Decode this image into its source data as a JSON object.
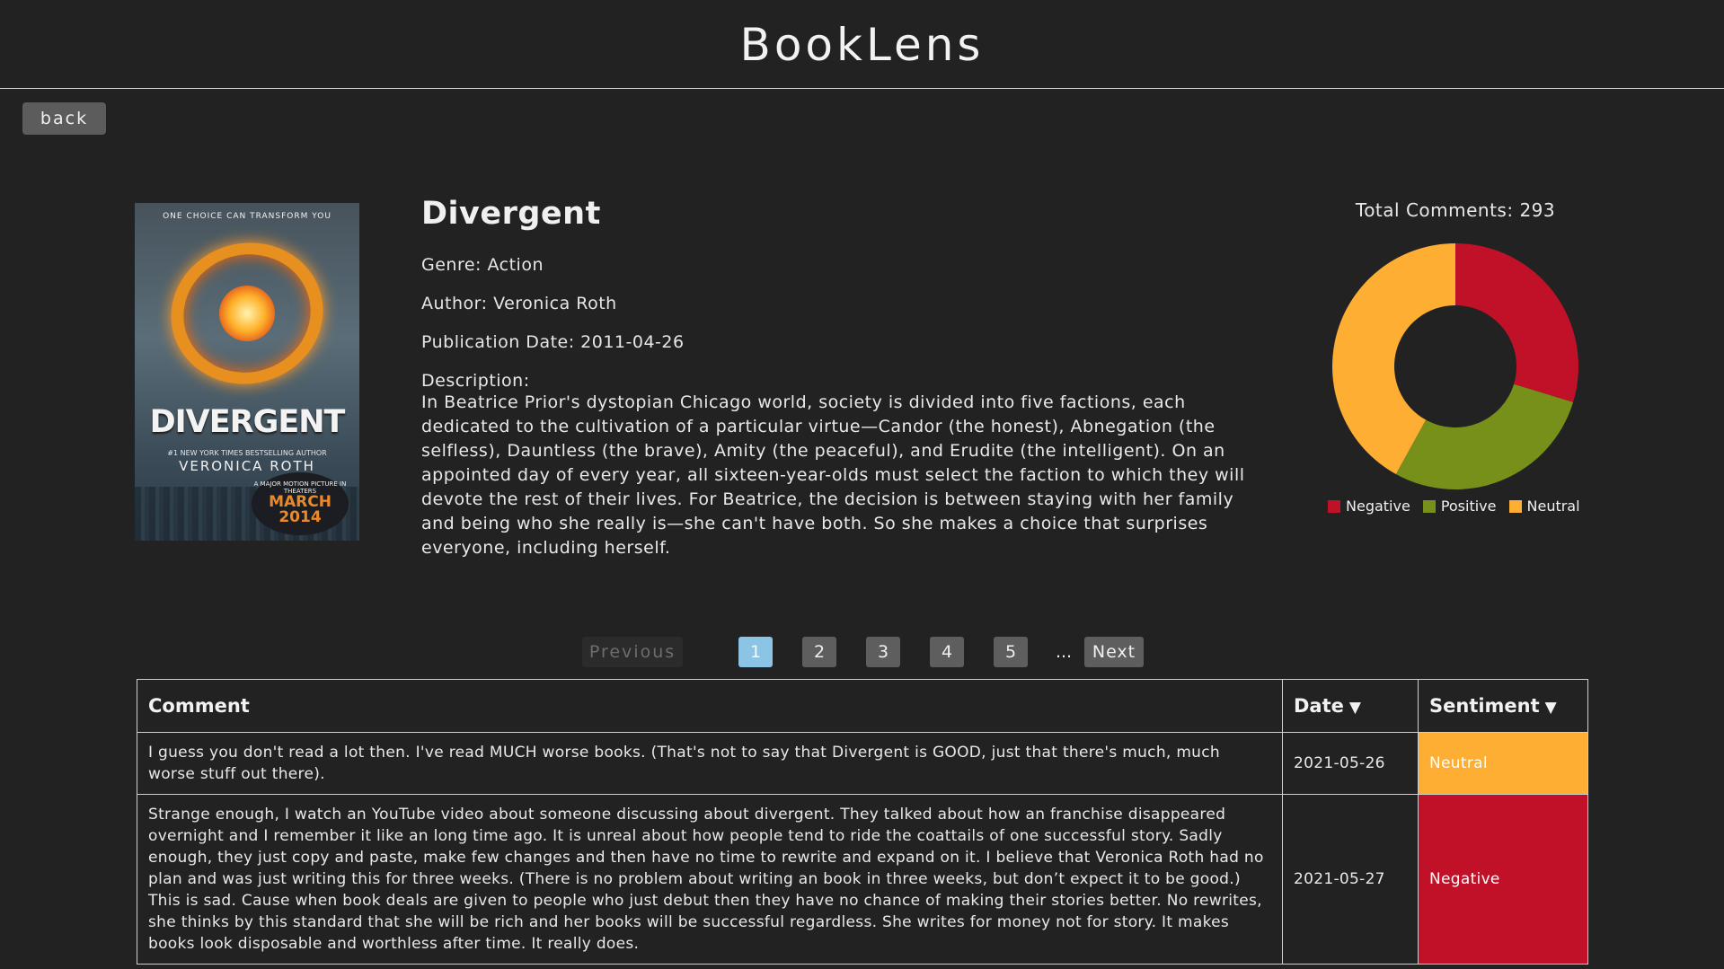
{
  "app": {
    "title": "BookLens"
  },
  "nav": {
    "back_label": "back"
  },
  "book": {
    "title": "Divergent",
    "genre": "Genre: Action",
    "author": "Author: Veronica Roth",
    "publication": "Publication Date: 2011-04-26",
    "description_label": "Description:",
    "description": "In Beatrice Prior's dystopian Chicago world, society is divided into five factions, each dedicated to the cultivation of a particular virtue—Candor (the honest), Abnegation (the selfless), Dauntless (the brave), Amity (the peaceful), and Erudite (the intelligent). On an appointed day of every year, all sixteen-year-olds must select the faction to which they will devote the rest of their lives. For Beatrice, the decision is between staying with her family and being who she really is—she can't have both. So she makes a choice that surprises everyone, including herself.",
    "cover": {
      "tagline": "ONE CHOICE CAN TRANSFORM YOU",
      "title": "DIVERGENT",
      "subline": "#1 NEW YORK TIMES BESTSELLING AUTHOR",
      "author": "VERONICA ROTH",
      "badge_small": "A MAJOR MOTION PICTURE IN THEATERS",
      "badge_big": "MARCH 2014"
    }
  },
  "chart_data": {
    "type": "pie",
    "title": "Total Comments: 293",
    "categories": [
      "Negative",
      "Positive",
      "Neutral"
    ],
    "values": [
      87,
      83,
      123
    ],
    "colors": [
      "#c01128",
      "#77901a",
      "#fdae33"
    ],
    "legend_position": "bottom"
  },
  "pagination": {
    "previous": "Previous",
    "pages": [
      "1",
      "2",
      "3",
      "4",
      "5"
    ],
    "active": "1",
    "ellipsis": "...",
    "next": "Next"
  },
  "table": {
    "headers": {
      "comment": "Comment",
      "date": "Date",
      "sentiment": "Sentiment",
      "sort_icon": "▼"
    },
    "rows": [
      {
        "comment": "I guess you don't read a lot then. I've read MUCH worse books. (That's not to say that Divergent is GOOD, just that there's much, much worse stuff out there).",
        "date": "2021-05-26",
        "sentiment": "Neutral"
      },
      {
        "comment": "Strange enough, I watch an YouTube video about someone discussing about divergent. They talked about how an franchise disappeared overnight and I remember it like an long time ago. It is unreal about how people tend to ride the coattails of one successful story. Sadly enough, they just copy and paste, make few changes and then have no time to rewrite and expand on it. I believe that Veronica Roth had no plan and was just writing this for three weeks. (There is no problem about writing an book in three weeks, but don’t expect it to be good.) This is sad. Cause when book deals are given to people who just debut then they have no chance of making their stories better. No rewrites, she thinks by this standard that she will be rich and her books will be successful regardless. She writes for money not for story. It makes books look disposable and worthless after time. It really does.",
        "date": "2021-05-27",
        "sentiment": "Negative"
      }
    ]
  }
}
